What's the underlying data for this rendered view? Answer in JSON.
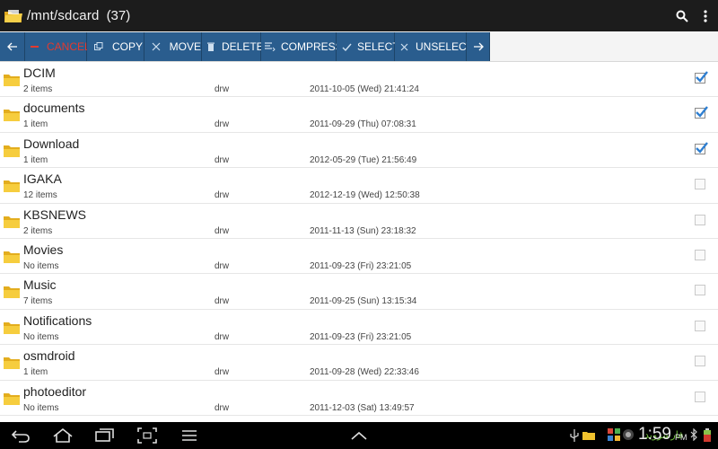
{
  "titlebar": {
    "path": "/mnt/sdcard",
    "count": "(37)",
    "icons": [
      "folder-icon",
      "search-icon",
      "overflow-menu-icon"
    ]
  },
  "toolbar": {
    "back": "",
    "cancel": "CANCEL",
    "copy": "COPY",
    "move": "MOVE",
    "delete": "DELETE",
    "compress": "COMPRESS",
    "select": "SELECT",
    "unselect": "UNSELECT",
    "forward": ""
  },
  "files": [
    {
      "name": "DCIM",
      "items": "2 items",
      "perm": "drw",
      "date": "2011-10-05 (Wed) 21:41:24",
      "checked": true
    },
    {
      "name": "documents",
      "items": "1 item",
      "perm": "drw",
      "date": "2011-09-29 (Thu) 07:08:31",
      "checked": true
    },
    {
      "name": "Download",
      "items": "1 item",
      "perm": "drw",
      "date": "2012-05-29 (Tue) 21:56:49",
      "checked": true
    },
    {
      "name": "IGAKA",
      "items": "12 items",
      "perm": "drw",
      "date": "2012-12-19 (Wed) 12:50:38",
      "checked": false
    },
    {
      "name": "KBSNEWS",
      "items": "2 items",
      "perm": "drw",
      "date": "2011-11-13 (Sun) 23:18:32",
      "checked": false
    },
    {
      "name": "Movies",
      "items": "No items",
      "perm": "drw",
      "date": "2011-09-23 (Fri) 23:21:05",
      "checked": false
    },
    {
      "name": "Music",
      "items": "7 items",
      "perm": "drw",
      "date": "2011-09-25 (Sun) 13:15:34",
      "checked": false
    },
    {
      "name": "Notifications",
      "items": "No items",
      "perm": "drw",
      "date": "2011-09-23 (Fri) 23:21:05",
      "checked": false
    },
    {
      "name": "osmdroid",
      "items": "1 item",
      "perm": "drw",
      "date": "2011-09-28 (Wed) 22:33:46",
      "checked": false
    },
    {
      "name": "photoeditor",
      "items": "No items",
      "perm": "drw",
      "date": "2011-12-03 (Sat) 13:49:57",
      "checked": false
    }
  ],
  "systembar": {
    "time": "1:59",
    "ampm": "PM",
    "watermark": "فارسروید",
    "nav_icons": [
      "back-nav-icon",
      "home-nav-icon",
      "recent-apps-icon",
      "screenshot-icon",
      "menu-icon",
      "chevron-up-icon"
    ]
  },
  "colors": {
    "toolbar_button": "#2a5d8e",
    "cancel_text": "#e23a2f",
    "folder": "#f0c22e",
    "checkmark": "#2f7fd1"
  }
}
